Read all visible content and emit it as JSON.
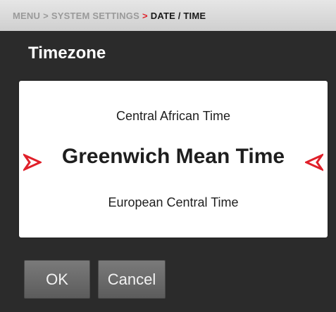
{
  "breadcrumb": {
    "menu": "MENU",
    "sep1": ">",
    "system_settings": "SYSTEM SETTINGS",
    "sep2": ">",
    "current": "DATE / TIME"
  },
  "title": "Timezone",
  "picker": {
    "previous": "Central African Time",
    "selected": "Greenwich Mean Time",
    "next": "European Central Time"
  },
  "buttons": {
    "ok": "OK",
    "cancel": "Cancel"
  },
  "colors": {
    "accent": "#e0202a",
    "background": "#2b2b2b"
  }
}
